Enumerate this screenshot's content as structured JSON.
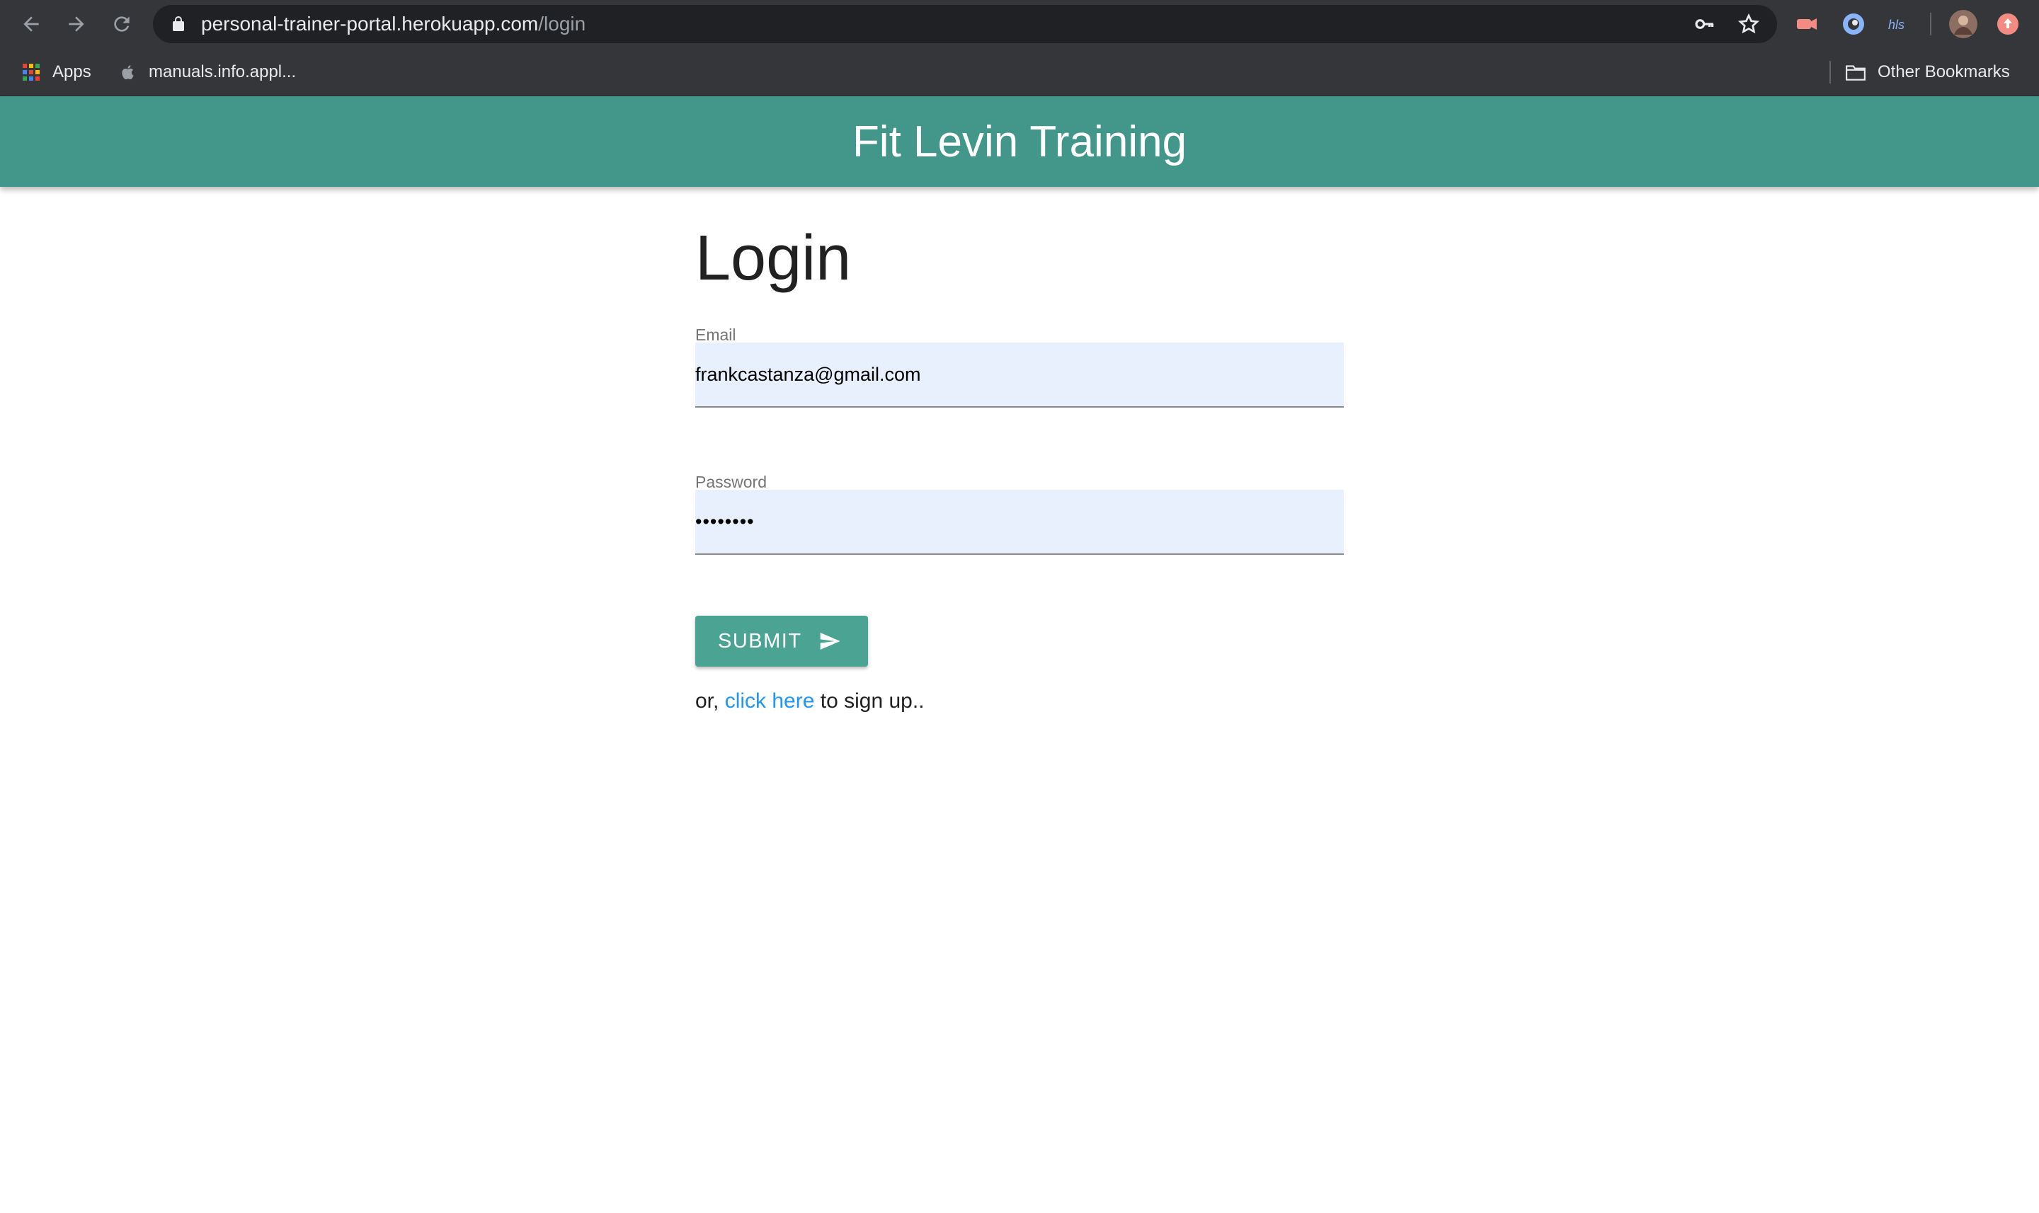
{
  "browser": {
    "url_host": "personal-trainer-portal.herokuapp.com",
    "url_path": "/login",
    "icons": {
      "back": "back-arrow-icon",
      "forward": "forward-arrow-icon",
      "reload": "reload-icon",
      "lock": "lock-icon",
      "key": "key-icon",
      "star": "star-icon"
    }
  },
  "bookmarks": {
    "apps_label": "Apps",
    "manuals_label": "manuals.info.appl...",
    "other_label": "Other Bookmarks"
  },
  "header": {
    "title": "Fit Levin Training",
    "color": "#43978a"
  },
  "login": {
    "heading": "Login",
    "email_label": "Email",
    "email_value": "frankcastanza@gmail.com",
    "password_label": "Password",
    "password_value": "••••••••",
    "submit_label": "SUBMIT",
    "signup_prefix": "or,",
    "signup_link": "click here",
    "signup_suffix": "to sign up..",
    "button_color": "#4aa393",
    "link_color": "#2196f3"
  }
}
